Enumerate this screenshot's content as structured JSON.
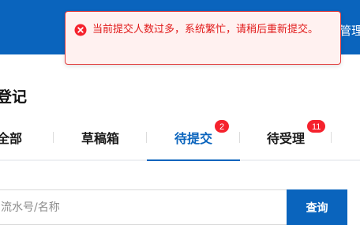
{
  "topbar": {
    "right_link": "管理"
  },
  "page": {
    "title": "登记"
  },
  "tabs": [
    {
      "label": "全部"
    },
    {
      "label": "草稿箱"
    },
    {
      "label": "待提交",
      "badge": "2",
      "active": true
    },
    {
      "label": "待受理",
      "badge": "11"
    }
  ],
  "search": {
    "placeholder": "流水号/名称",
    "button_label": "查询"
  },
  "toast": {
    "type": "error",
    "message": "当前提交人数过多，系统繁忙，请稍后重新提交。"
  },
  "colors": {
    "primary": "#0a64bd",
    "error": "#e11a1a",
    "badge": "#f5222d"
  }
}
